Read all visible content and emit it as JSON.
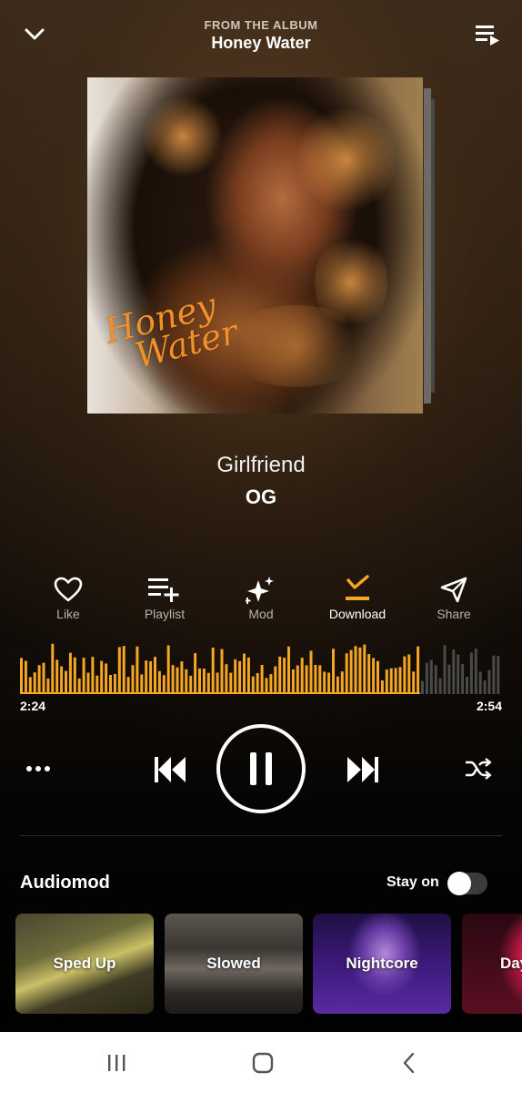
{
  "header": {
    "from_label": "FROM THE ALBUM",
    "album_title": "Honey Water",
    "left_icon": "chevron-down-icon",
    "right_icon": "queue-icon"
  },
  "album_art": {
    "script_text_line1": "Honey",
    "script_text_line2": "Water"
  },
  "song": {
    "title": "Girlfriend",
    "artist": "OG"
  },
  "actions": [
    {
      "label": "Like",
      "icon": "heart-icon"
    },
    {
      "label": "Playlist",
      "icon": "playlist-add-icon"
    },
    {
      "label": "Mod",
      "icon": "sparkle-icon"
    },
    {
      "label": "Download",
      "icon": "download-icon",
      "active": true
    },
    {
      "label": "Share",
      "icon": "send-icon"
    }
  ],
  "player": {
    "elapsed": "2:24",
    "duration": "2:54",
    "progress_fraction": 0.83,
    "state": "playing"
  },
  "colors": {
    "accent": "#f5a623",
    "wave_played": "#f5a623",
    "wave_unplayed": "#4a4a4a"
  },
  "audiomod": {
    "title": "Audiomod",
    "stay_on_label": "Stay on",
    "stay_on": false,
    "cards": [
      {
        "label": "Sped Up"
      },
      {
        "label": "Slowed"
      },
      {
        "label": "Nightcore"
      },
      {
        "label": "Day"
      }
    ]
  },
  "system_nav": {
    "recents_icon": "recents-icon",
    "home_icon": "home-icon",
    "back_icon": "back-icon"
  }
}
